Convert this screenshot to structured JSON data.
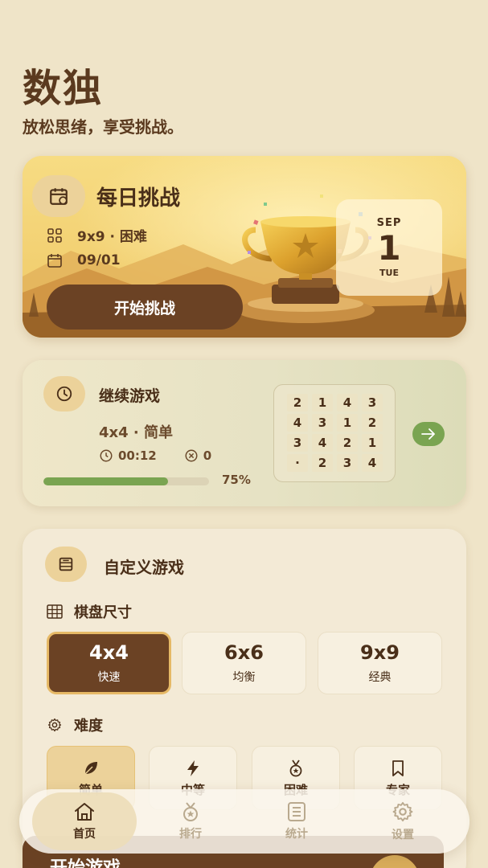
{
  "header": {
    "title": "数独",
    "subtitle": "放松思绪，享受挑战。"
  },
  "daily": {
    "icon": "calendar-icon",
    "title": "每日挑战",
    "grid_icon": "grid-icon",
    "size_difficulty": "9x9 · 困难",
    "date_icon": "calendar-small-icon",
    "date": "09/01",
    "start_label": "开始挑战",
    "calendar": {
      "month": "SEP",
      "day": "1",
      "weekday": "TUE"
    },
    "trophy_icon": "trophy-icon"
  },
  "continue": {
    "icon": "clock-icon",
    "title": "继续游戏",
    "mode": "4x4 · 简单",
    "time": "00:12",
    "mistakes": "0",
    "progress": 0.75,
    "progress_label": "75%",
    "board": [
      [
        "2",
        "1",
        "4",
        "3"
      ],
      [
        "4",
        "3",
        "1",
        "2"
      ],
      [
        "3",
        "4",
        "2",
        "1"
      ],
      [
        "·",
        "2",
        "3",
        "4"
      ]
    ],
    "arrow_icon": "arrow-right-icon"
  },
  "custom": {
    "icon": "board-icon",
    "title": "自定义游戏",
    "size_heading": "棋盘尺寸",
    "sizes": [
      {
        "value": "4x4",
        "label": "快速"
      },
      {
        "value": "6x6",
        "label": "均衡"
      },
      {
        "value": "9x9",
        "label": "经典"
      }
    ],
    "difficulty_heading": "难度",
    "difficulties": [
      {
        "label": "简单",
        "icon": "leaf-icon"
      },
      {
        "label": "中等",
        "icon": "lightning-icon"
      },
      {
        "label": "困难",
        "icon": "medal-icon"
      },
      {
        "label": "专家",
        "icon": "bookmark-icon"
      }
    ],
    "start_label": "开始游戏"
  },
  "nav": {
    "items": [
      {
        "label": "首页",
        "icon": "home-icon"
      },
      {
        "label": "排行",
        "icon": "ranking-icon"
      },
      {
        "label": "统计",
        "icon": "stats-icon"
      },
      {
        "label": "设置",
        "icon": "settings-icon"
      }
    ]
  },
  "colors": {
    "background": "#efe4c8",
    "primary_brown": "#6b4224",
    "accent_gold": "#ecd29a",
    "progress_green": "#7aa451"
  }
}
